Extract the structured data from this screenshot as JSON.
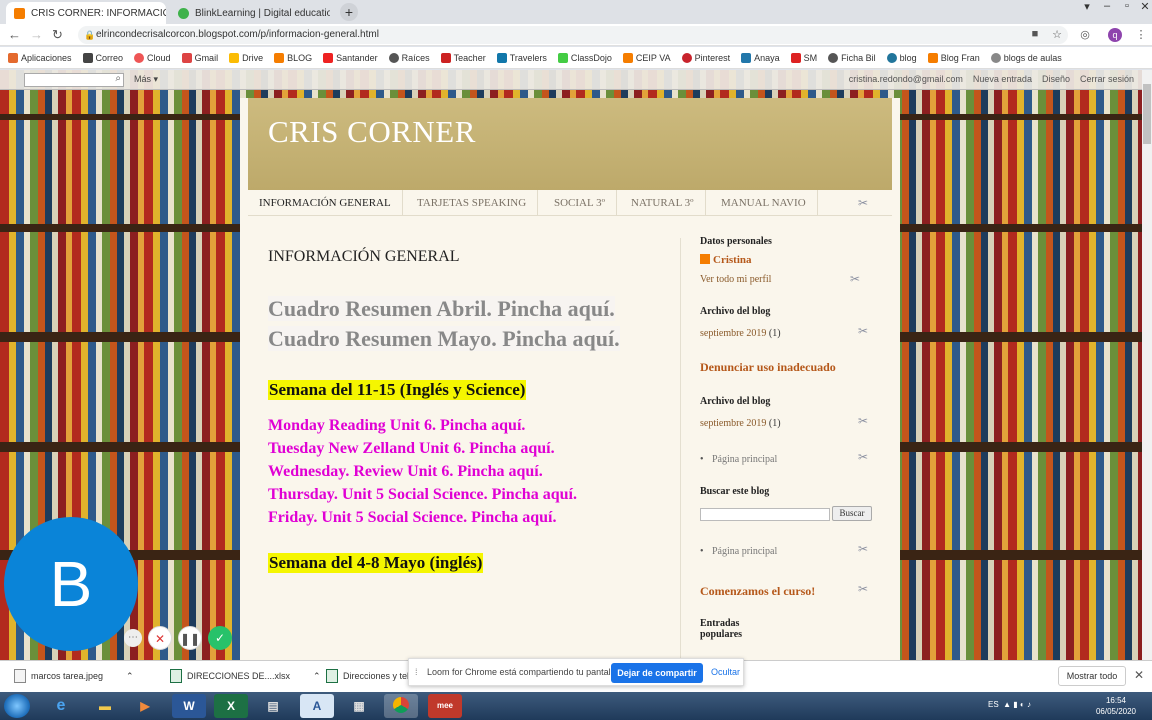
{
  "browser": {
    "tabs": [
      {
        "title": "CRIS CORNER: INFORMACIÓN G",
        "active": true
      },
      {
        "title": "BlinkLearning | Digital educatio",
        "active": false
      }
    ],
    "url": "elrincondecrisalcorcon.blogspot.com/p/informacion-general.html",
    "profile_initial": "q",
    "bookmarks": [
      "Aplicaciones",
      "Correo",
      "Cloud",
      "Gmail",
      "Drive",
      "BLOG",
      "Santander",
      "Raíces",
      "Teacher",
      "Travelers",
      "ClassDojo",
      "CEIP VA",
      "Pinterest",
      "Anaya",
      "SM",
      "Ficha Bil",
      "blog",
      "Blog Fran",
      "blogs de aulas"
    ]
  },
  "blogger_nav": {
    "mas": "Más ▾",
    "email": "cristina.redondo@gmail.com",
    "new_entry": "Nueva entrada",
    "design": "Diseño",
    "logout": "Cerrar sesión"
  },
  "blog": {
    "title": "CRIS CORNER",
    "pages": [
      "INFORMACIÓN GENERAL",
      "TARJETAS SPEAKING",
      "SOCIAL 3º",
      "NATURAL 3º",
      "MANUAL NAVIO"
    ]
  },
  "post": {
    "title": "INFORMACIÓN GENERAL",
    "link1": "Cuadro Resumen Abril. Pincha aquí.",
    "link2": "Cuadro Resumen Mayo. Pincha aquí.",
    "week1": "Semana del 11-15 (Inglés y Science)",
    "days": [
      "Monday Reading Unit 6. Pincha aquí.",
      "Tuesday New Zelland Unit 6. Pincha aquí.",
      "Wednesday. Review Unit 6. Pincha aquí.",
      "Thursday. Unit 5 Social Science. Pincha aquí.",
      "Friday. Unit 5 Social Science. Pincha aquí."
    ],
    "week2": "Semana del 4-8 Mayo (inglés)"
  },
  "sidebar": {
    "personal_h": "Datos personales",
    "author": "Cristina",
    "profile_link": "Ver todo mi perfil",
    "archive_h": "Archivo del blog",
    "archive_item": "septiembre 2019",
    "archive_count": "(1)",
    "report": "Denunciar uso inadecuado",
    "archive_h2": "Archivo del blog",
    "archive_item2": "septiembre 2019",
    "archive_count2": "(1)",
    "home1": "Página principal",
    "search_h": "Buscar este blog",
    "search_btn": "Buscar",
    "home2": "Página principal",
    "start": "Comenzamos el curso!",
    "popular_h": "Entradas populares"
  },
  "loom": {
    "avatar_letter": "B",
    "share_text": "Loom for Chrome está compartiendo tu pantalla.",
    "share_btn": "Dejar de compartir",
    "hide_btn": "Ocultar"
  },
  "downloads": {
    "items": [
      "marcos tarea.jpeg",
      "DIRECCIONES DE....xlsx",
      "Direcciones y telé"
    ],
    "show_all": "Mostrar todo"
  },
  "taskbar": {
    "lang": "ES",
    "time": "16:54",
    "date": "06/05/2020"
  },
  "colors": {
    "accent": "#1a73e8",
    "title_band": "#c8b67a",
    "highlight": "#f5f600",
    "magenta_link": "#e000d4"
  }
}
